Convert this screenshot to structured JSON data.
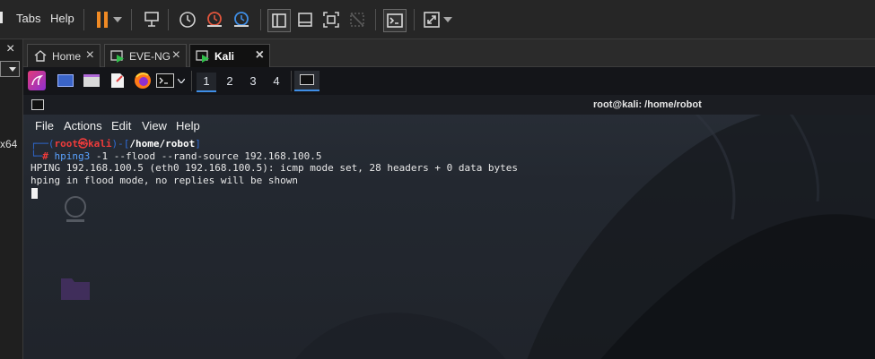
{
  "menubar": {
    "items": [
      "Tabs",
      "Help"
    ]
  },
  "side": {
    "label": "x64"
  },
  "tabs": [
    {
      "label": "Home"
    },
    {
      "label": "EVE-NG"
    },
    {
      "label": "Kali"
    }
  ],
  "panel": {
    "workspaces": [
      "1",
      "2",
      "3",
      "4"
    ]
  },
  "terminal": {
    "title": "root@kali: /home/robot",
    "menu": [
      "File",
      "Actions",
      "Edit",
      "View",
      "Help"
    ],
    "prompt_user": "root",
    "prompt_at": "㉿",
    "prompt_host": "kali",
    "prompt_path": "/home/robot",
    "command_name": "hping3",
    "command_args": " -1 --flood --rand-source 192.168.100.5",
    "output": [
      "HPING 192.168.100.5 (eth0 192.168.100.5): icmp mode set, 28 headers + 0 data bytes",
      "hping in flood mode, no replies will be shown"
    ]
  },
  "colors": {
    "prompt_blue": "#2f6bd6",
    "prompt_red": "#ef3b3b",
    "command_blue": "#5aa2ff",
    "pause_orange": "#f08a24",
    "snapshot_red": "#e2553c"
  }
}
